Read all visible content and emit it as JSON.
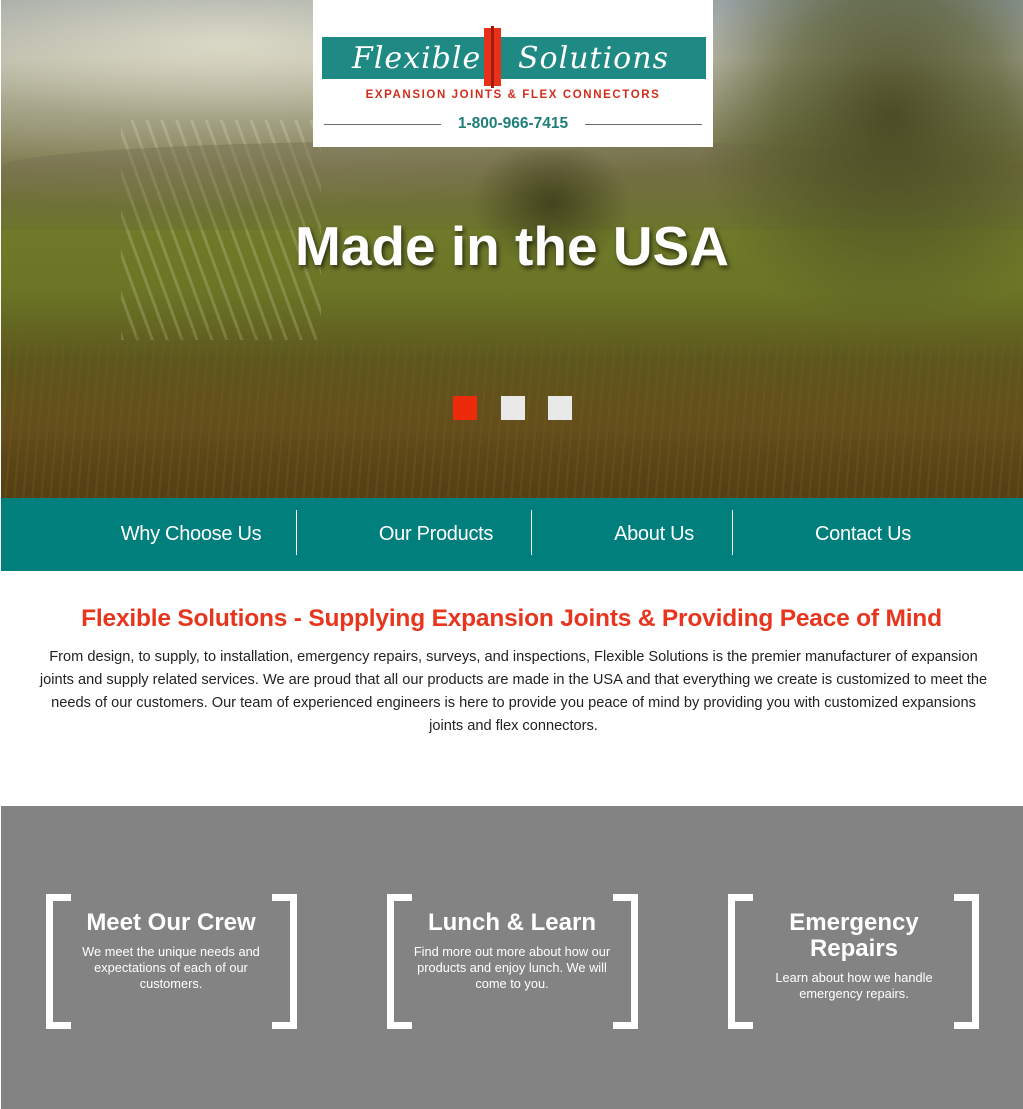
{
  "logo": {
    "word_left": "Flexible",
    "word_right": "Solutions",
    "tagline": "EXPANSION JOINTS & FLEX CONNECTORS",
    "phone": "1-800-966-7415"
  },
  "hero": {
    "title": "Made in the USA",
    "slides_total": 3,
    "active_slide": 1
  },
  "nav": {
    "items": [
      {
        "label": "Why Choose Us"
      },
      {
        "label": "Our Products"
      },
      {
        "label": "About Us"
      },
      {
        "label": "Contact Us"
      }
    ]
  },
  "intro": {
    "title": "Flexible Solutions - Supplying Expansion Joints & Providing Peace of Mind",
    "body": "From design, to supply, to installation, emergency repairs, surveys, and inspections, Flexible Solutions is the premier manufacturer of expansion joints and supply related services. We are proud that all our products are made in the USA and that everything we create is customized to meet the needs of our customers. Our team of experienced engineers is here to provide you peace of mind by providing you with customized expansions joints and flex connectors."
  },
  "features": [
    {
      "title": "Meet Our Crew",
      "desc": "We meet the unique needs and expectations of each of our customers."
    },
    {
      "title": "Lunch & Learn",
      "desc": "Find more out more about how our products and enjoy lunch. We will come to you."
    },
    {
      "title": "Emergency Repairs",
      "desc": "Learn about how we handle emergency repairs."
    }
  ],
  "colors": {
    "teal": "#007f7d",
    "accent_red": "#e8361e",
    "features_bg": "#838383"
  }
}
